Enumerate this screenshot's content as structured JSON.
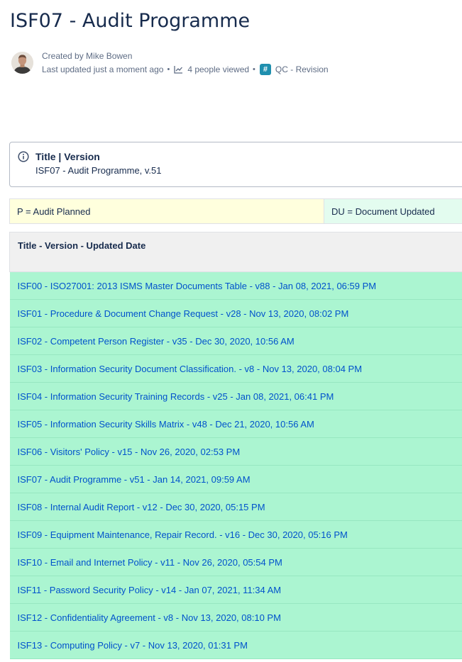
{
  "page": {
    "title": "ISF07 - Audit Programme"
  },
  "byline": {
    "created_by": "Created by Mike Bowen",
    "last_updated": "Last updated just a moment ago",
    "separator": "•",
    "views": "4 people viewed",
    "space": "QC - Revision",
    "space_icon_glyph": "#"
  },
  "info_panel": {
    "title": "Title | Version",
    "body": "ISF07 - Audit Programme, v.51"
  },
  "legend": {
    "planned": "P = Audit Planned",
    "updated": "DU = Document Updated"
  },
  "table": {
    "header": "Title - Version - Updated Date",
    "rows": [
      "ISF00 - ISO27001: 2013 ISMS Master Documents Table - v88 - Jan 08, 2021, 06:59 PM",
      "ISF01 - Procedure & Document Change Request - v28 - Nov 13, 2020, 08:02 PM",
      "ISF02 - Competent Person Register - v35 - Dec 30, 2020, 10:56 AM",
      "ISF03 - Information Security Document Classification. - v8 - Nov 13, 2020, 08:04 PM",
      "ISF04 - Information Security Training Records - v25 - Jan 08, 2021, 06:41 PM",
      "ISF05 - Information Security Skills Matrix - v48 - Dec 21, 2020, 10:56 AM",
      "ISF06 - Visitors' Policy - v15 - Nov 26, 2020, 02:53 PM",
      "ISF07 - Audit Programme - v51 - Jan 14, 2021, 09:59 AM",
      "ISF08 - Internal Audit Report - v12 - Dec 30, 2020, 05:15 PM",
      "ISF09 - Equipment Maintenance, Repair Record. - v16 - Dec 30, 2020, 05:16 PM",
      "ISF10 - Email and Internet Policy - v11 - Nov 26, 2020, 05:54 PM",
      "ISF11 - Password Security Policy - v14 - Jan 07, 2021, 11:34 AM",
      "ISF12 - Confidentiality Agreement - v8 - Nov 13, 2020, 08:10 PM",
      "ISF13 - Computing Policy - v7 - Nov 13, 2020, 01:31 PM"
    ]
  },
  "colors": {
    "text": "#172b4d",
    "meta_text": "#5e6c84",
    "link": "#0052cc",
    "row_background": "#abf5d1",
    "header_background": "#f0f0f0",
    "legend_planned_background": "#ffffdd",
    "legend_updated_background": "#e3fcef"
  },
  "icons": {
    "avatar": "user-avatar-photo",
    "views": "line-chart-icon",
    "space": "hash-space-icon",
    "info": "info-circle-icon"
  }
}
